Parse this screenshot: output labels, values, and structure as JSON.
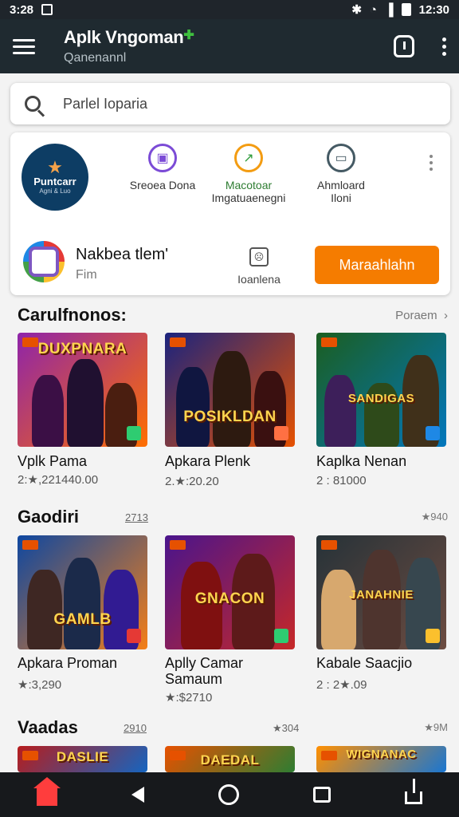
{
  "status_bar": {
    "time_left": "3:28",
    "time_right": "12:30"
  },
  "app_bar": {
    "title": "Aplk Vngoman",
    "subtitle": "Qanenannl"
  },
  "search": {
    "placeholder": "Parlel Ioparia"
  },
  "brand": {
    "name": "Puntcarr",
    "sub": "Agni & Luo"
  },
  "quick_actions": [
    {
      "label": "Sreoea Dona",
      "icon": "controller-icon",
      "color": "#7b4bd6"
    },
    {
      "label": "Macotoar",
      "sublabel": "Imgatuaenegni",
      "icon": "map-icon",
      "color": "#f39c12"
    },
    {
      "label": "Ahmloard",
      "sublabel": "Iloni",
      "icon": "monitor-icon",
      "color": "#455a64"
    }
  ],
  "promo": {
    "title": "Nakbea tlem'",
    "subtitle": "Fim",
    "middle_label": "Ioanlena",
    "cta_label": "Maraahlahn"
  },
  "sections": [
    {
      "title": "Carulfnonos:",
      "link": "Poraem",
      "apps": [
        {
          "name": "Vplk Pama",
          "meta": "2:★,221440.00",
          "tile_text": "DUXPNARA",
          "color_a": "#8e24aa",
          "color_b": "#ff6f00"
        },
        {
          "name": "Apkara Plenk",
          "meta": "2.★:20.20",
          "tile_text": "POSIKLDAN",
          "color_a": "#1a237e",
          "color_b": "#e65100"
        },
        {
          "name": "Kaplka Nenan",
          "meta": "2 : 81000",
          "tile_text": "SANDIGAS",
          "color_a": "#1b5e20",
          "color_b": "#0277bd"
        }
      ]
    },
    {
      "title": "Gaodiri",
      "badge": "2713",
      "link": "★940",
      "apps": [
        {
          "name": "Apkara Proman",
          "meta": "★:3,290",
          "tile_text": "GAMLB",
          "color_a": "#0d47a1",
          "color_b": "#f57f17"
        },
        {
          "name": "Aplly Camar",
          "name2": "Samaum",
          "meta": "★:$2710",
          "tile_text": "GNACON",
          "color_a": "#4a148c",
          "color_b": "#c62828"
        },
        {
          "name": "Kabale Saacjio",
          "meta": "2 : 2★.09",
          "tile_text": "JANAHNIE",
          "color_a": "#263238",
          "color_b": "#6d4c41"
        }
      ]
    },
    {
      "title": "Vaadas",
      "badge": "2910",
      "link_mid": "★304",
      "link": "★9M",
      "apps": [
        {
          "tile_text": "DASLIE",
          "color_a": "#b71c1c",
          "color_b": "#1565c0"
        },
        {
          "tile_text": "DAEDAL",
          "color_a": "#e65100",
          "color_b": "#2e7d32"
        },
        {
          "tile_text": "WIGNANAC",
          "color_a": "#ff8f00",
          "color_b": "#1976d2"
        }
      ]
    }
  ]
}
